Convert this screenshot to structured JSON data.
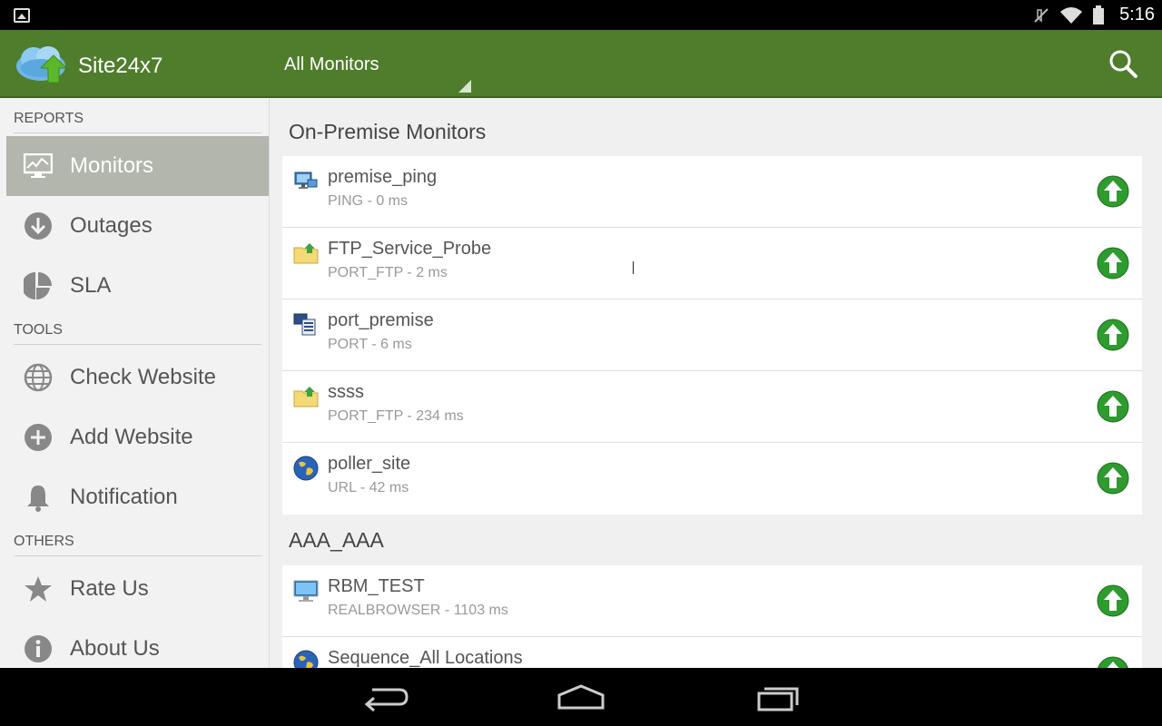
{
  "status_bar": {
    "time": "5:16",
    "icons": [
      "image-notification-icon",
      "muted-icon",
      "wifi-icon",
      "battery-icon"
    ]
  },
  "action_bar": {
    "app_title": "Site24x7",
    "filter_label": "All Monitors",
    "search_icon": "search-icon",
    "color": "#4f7d2c"
  },
  "drawer": {
    "sections": [
      {
        "title": "REPORTS",
        "items": [
          {
            "label": "Monitors",
            "icon": "monitor-graph-icon",
            "active": true
          },
          {
            "label": "Outages",
            "icon": "down-arrow-circle-icon"
          },
          {
            "label": "SLA",
            "icon": "pie-chart-icon"
          }
        ]
      },
      {
        "title": "TOOLS",
        "items": [
          {
            "label": "Check Website",
            "icon": "globe-icon"
          },
          {
            "label": "Add Website",
            "icon": "plus-circle-icon"
          },
          {
            "label": "Notification",
            "icon": "bell-icon"
          }
        ]
      },
      {
        "title": "OTHERS",
        "items": [
          {
            "label": "Rate Us",
            "icon": "star-icon"
          },
          {
            "label": "About Us",
            "icon": "info-icon"
          }
        ]
      }
    ]
  },
  "content": {
    "groups": [
      {
        "title": "On-Premise Monitors",
        "monitors": [
          {
            "name": "premise_ping",
            "detail": "PING - 0 ms",
            "icon": "ping-monitor-icon",
            "status": "up"
          },
          {
            "name": "FTP_Service_Probe",
            "detail": "PORT_FTP - 2 ms",
            "icon": "ftp-folder-icon",
            "status": "up"
          },
          {
            "name": "port_premise",
            "detail": "PORT - 6 ms",
            "icon": "port-monitor-icon",
            "status": "up"
          },
          {
            "name": "ssss",
            "detail": "PORT_FTP - 234 ms",
            "icon": "ftp-folder-icon",
            "status": "up"
          },
          {
            "name": "poller_site",
            "detail": "URL - 42 ms",
            "icon": "globe-url-icon",
            "status": "up"
          }
        ]
      },
      {
        "title": "AAA_AAA",
        "monitors": [
          {
            "name": "RBM_TEST",
            "detail": "REALBROWSER - 1103 ms",
            "icon": "desktop-monitor-icon",
            "status": "up"
          },
          {
            "name": "Sequence_All Locations",
            "detail": "",
            "icon": "globe-url-icon",
            "status": "up"
          }
        ]
      }
    ],
    "status_up_color": "#2e9b2e"
  },
  "nav_bar": {
    "buttons": [
      "back-button",
      "home-button",
      "recents-button"
    ]
  }
}
